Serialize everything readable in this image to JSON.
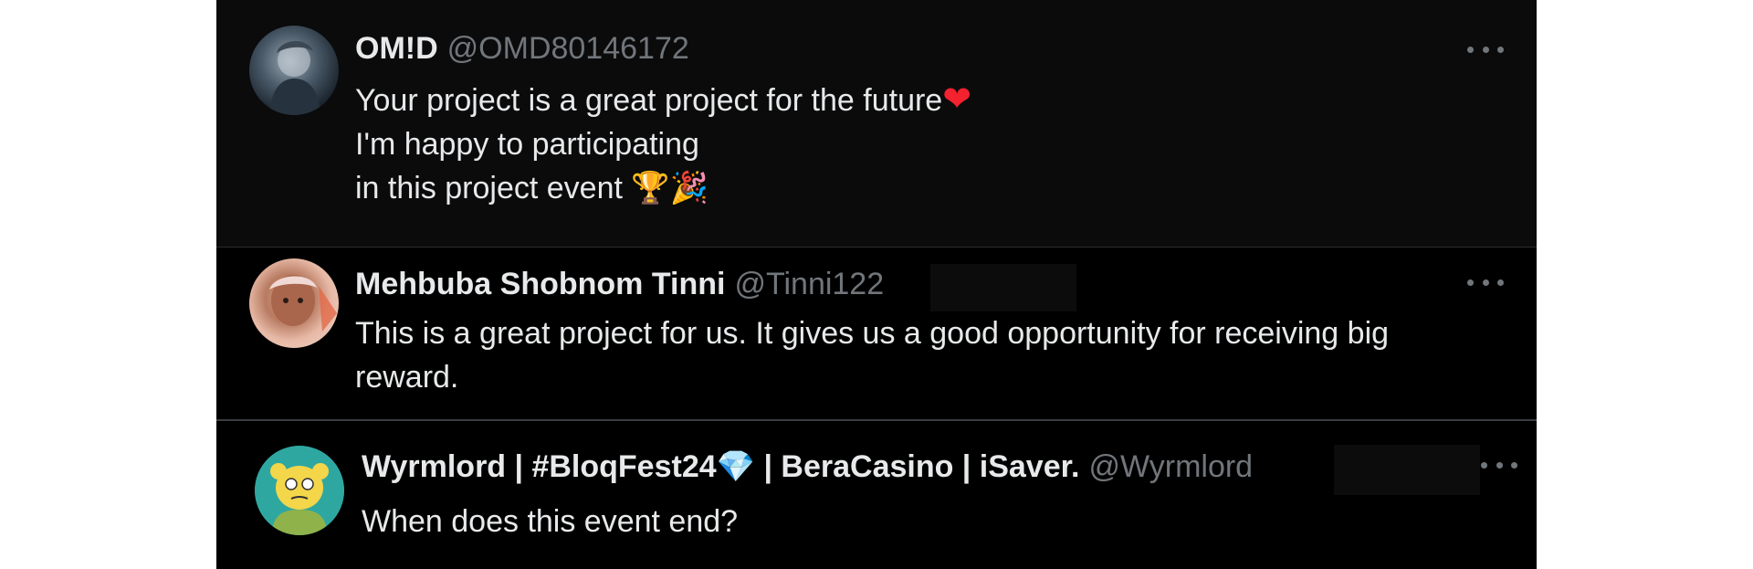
{
  "tweets": [
    {
      "name": "OM!D",
      "handle": "@OMD80146172",
      "lines": [
        "Your project is a great project for the future",
        "I'm happy to participating",
        "in this project event "
      ],
      "emoji": {
        "heart": "❤",
        "trophy": "🏆",
        "party": "🎉"
      }
    },
    {
      "name": "Mehbuba Shobnom Tinni",
      "handle": "@Tinni122",
      "lines": [
        "This is a great project for us. It gives us a good opportunity for receiving big",
        "reward."
      ]
    },
    {
      "name_part1": "Wyrmlord | #BloqFest24",
      "gem": "💎",
      "name_part2": " | BeraCasino | iSaver.",
      "handle": "@Wyrmlord",
      "lines": [
        "When does this event end?"
      ]
    }
  ],
  "icons": {
    "more": "more-options-icon"
  },
  "colors": {
    "panel": "#000000",
    "text": "#e7e9ea",
    "muted": "#71767b",
    "divider": "#2a2d30"
  }
}
